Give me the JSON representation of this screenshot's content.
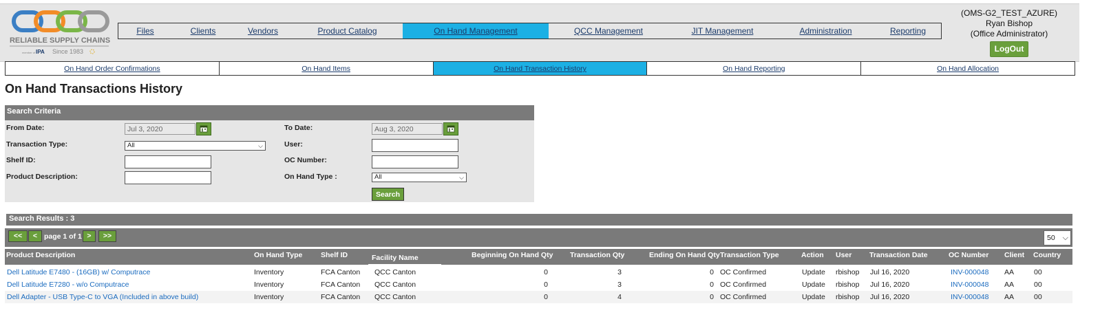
{
  "logo": {
    "brand_text": "RELIABLE SUPPLY CHAINS",
    "tagline": "Since 1983",
    "badge": "IPA",
    "badge_prefix": "member of"
  },
  "main_nav": [
    {
      "label": "Files",
      "active": false
    },
    {
      "label": "Clients",
      "active": false
    },
    {
      "label": "Vendors",
      "active": false
    },
    {
      "label": "Product Catalog",
      "active": false
    },
    {
      "label": "On Hand Management",
      "active": true
    },
    {
      "label": "QCC Management",
      "active": false
    },
    {
      "label": "JIT Management",
      "active": false
    },
    {
      "label": "Administration",
      "active": false
    },
    {
      "label": "Reporting",
      "active": false
    }
  ],
  "user": {
    "environment": "(OMS-G2_TEST_AZURE)",
    "name": "Ryan Bishop",
    "role": "(Office Administrator)",
    "logout_label": "LogOut"
  },
  "sub_nav": [
    {
      "label": "On Hand Order Confirmations",
      "active": false
    },
    {
      "label": "On Hand Items",
      "active": false
    },
    {
      "label": "On Hand Transaction History",
      "active": true
    },
    {
      "label": "On Hand Reporting",
      "active": false
    },
    {
      "label": "On Hand Allocation",
      "active": false
    }
  ],
  "page_title": "On Hand Transactions History",
  "search": {
    "header": "Search Criteria",
    "from_date_label": "From Date:",
    "from_date_value": "Jul 3, 2020",
    "to_date_label": "To Date:",
    "to_date_value": "Aug 3, 2020",
    "transaction_type_label": "Transaction Type:",
    "transaction_type_value": "All",
    "user_label": "User:",
    "user_value": "",
    "shelf_id_label": "Shelf ID:",
    "shelf_id_value": "",
    "oc_number_label": "OC Number:",
    "oc_number_value": "",
    "product_description_label": "Product Description:",
    "product_description_value": "",
    "on_hand_type_label": "On Hand Type :",
    "on_hand_type_value": "All",
    "search_button": "Search"
  },
  "results": {
    "summary": "Search Results : 3",
    "pager": {
      "first": "<<",
      "prev": "<",
      "page_text": "page 1 of 1",
      "next": ">",
      "last": ">>",
      "page_size": "50"
    },
    "columns": {
      "product_description": "Product Description",
      "on_hand_type": "On Hand Type",
      "shelf_id": "Shelf ID",
      "facility_name": "Facility Name",
      "beginning_qty": "Beginning On Hand Qty",
      "transaction_qty": "Transaction Qty",
      "ending_qty": "Ending On Hand Qty",
      "transaction_type": "Transaction Type",
      "action": "Action",
      "user": "User",
      "transaction_date": "Transaction Date",
      "oc_number": "OC Number",
      "client": "Client",
      "country": "Country"
    },
    "rows": [
      {
        "product_description": "Dell Latitude E7480 - (16GB) w/ Computrace",
        "on_hand_type": "Inventory",
        "shelf_id": "FCA Canton",
        "facility_name": "QCC Canton",
        "beginning_qty": "0",
        "transaction_qty": "3",
        "ending_qty": "0",
        "transaction_type": "OC Confirmed",
        "action": "Update",
        "user": "rbishop",
        "transaction_date": "Jul 16, 2020",
        "oc_number": "INV-000048",
        "client": "AA",
        "country": "00"
      },
      {
        "product_description": "Dell Latitude E7280 - w/o Computrace",
        "on_hand_type": "Inventory",
        "shelf_id": "FCA Canton",
        "facility_name": "QCC Canton",
        "beginning_qty": "0",
        "transaction_qty": "3",
        "ending_qty": "0",
        "transaction_type": "OC Confirmed",
        "action": "Update",
        "user": "rbishop",
        "transaction_date": "Jul 16, 2020",
        "oc_number": "INV-000048",
        "client": "AA",
        "country": "00"
      },
      {
        "product_description": "Dell Adapter - USB Type-C to VGA (Included in above build)",
        "on_hand_type": "Inventory",
        "shelf_id": "FCA Canton",
        "facility_name": "QCC Canton",
        "beginning_qty": "0",
        "transaction_qty": "4",
        "ending_qty": "0",
        "transaction_type": "OC Confirmed",
        "action": "Update",
        "user": "rbishop",
        "transaction_date": "Jul 16, 2020",
        "oc_number": "INV-000048",
        "client": "AA",
        "country": "00"
      }
    ]
  },
  "colors": {
    "accent_blue": "#1cb0e4",
    "button_green": "#6a9f3c",
    "header_gray": "#7a7a7a",
    "panel_gray": "#e6e6e6",
    "link_blue": "#1a6bbf"
  }
}
